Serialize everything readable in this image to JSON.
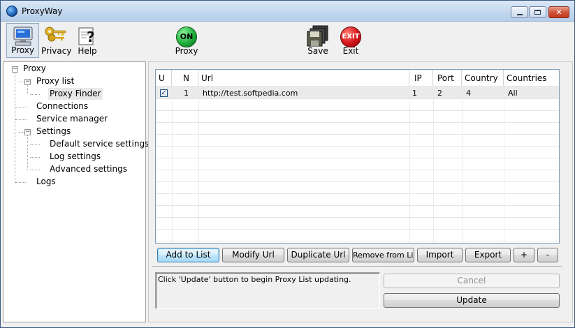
{
  "window": {
    "title": "ProxyWay"
  },
  "toolbar": {
    "proxy_label": "Proxy",
    "privacy_label": "Privacy",
    "help_label": "Help",
    "on_badge": "ON",
    "proxy_toggle_label": "Proxy",
    "save_label": "Save",
    "exit_badge": "EXIT",
    "exit_label": "Exit"
  },
  "tree": {
    "root": "Proxy",
    "proxy_list": "Proxy list",
    "proxy_finder": "Proxy Finder",
    "connections": "Connections",
    "service_manager": "Service manager",
    "settings": "Settings",
    "default_service_settings": "Default service settings",
    "log_settings": "Log settings",
    "advanced_settings": "Advanced settings",
    "logs": "Logs"
  },
  "grid": {
    "columns": [
      "U",
      "N",
      "Url",
      "IP",
      "Port",
      "Country",
      "Countries"
    ],
    "rows": [
      {
        "checked": true,
        "n": "1",
        "url": "http://test.softpedia.com",
        "ip": "1",
        "port": "2",
        "country": "4",
        "countries": "All"
      }
    ]
  },
  "buttons": {
    "add_to_list": "Add to List",
    "modify_url": "Modify Url",
    "duplicate_url": "Duplicate Url",
    "remove_from_list": "Remove from List",
    "import": "Import",
    "export": "Export",
    "plus": "+",
    "minus": "-",
    "cancel": "Cancel",
    "update": "Update"
  },
  "status": {
    "message": "Click 'Update' button to begin Proxy List updating."
  },
  "colors": {
    "titlebar": "#c4d8ef",
    "on_button": "#1fae3a",
    "exit_button": "#d3141a",
    "selection": "#dfe7f1"
  }
}
